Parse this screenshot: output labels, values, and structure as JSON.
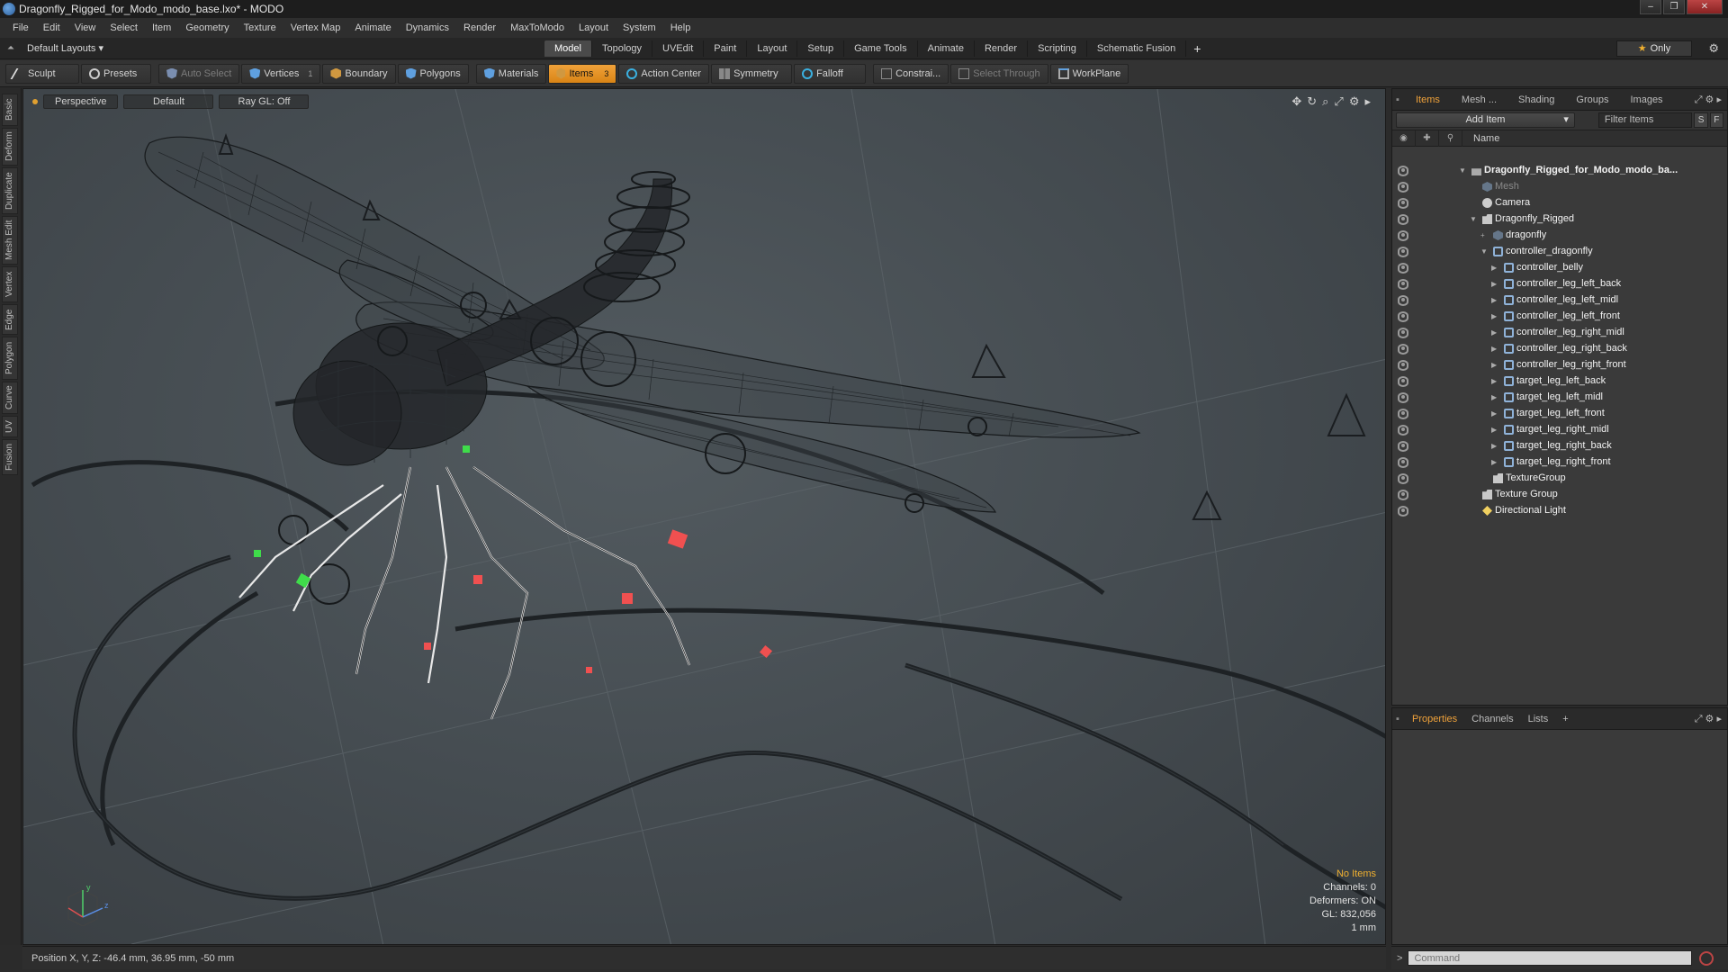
{
  "window": {
    "title": "Dragonfly_Rigged_for_Modo_modo_base.lxo* - MODO",
    "minimize": "–",
    "maximize": "❐",
    "close": "✕"
  },
  "menu": [
    "File",
    "Edit",
    "View",
    "Select",
    "Item",
    "Geometry",
    "Texture",
    "Vertex Map",
    "Animate",
    "Dynamics",
    "Render",
    "MaxToModo",
    "Layout",
    "System",
    "Help"
  ],
  "layoutbar": {
    "layouts_label": "Default Layouts ▾",
    "tabs": [
      "Model",
      "Topology",
      "UVEdit",
      "Paint",
      "Layout",
      "Setup",
      "Game Tools",
      "Animate",
      "Render",
      "Scripting",
      "Schematic Fusion"
    ],
    "active_tab": "Model",
    "plus": "+",
    "only_label": "Only"
  },
  "toolbar": {
    "sculpt": "Sculpt",
    "presets": "Presets",
    "auto_select": "Auto Select",
    "vertices": "Vertices",
    "vertices_count": "1",
    "boundary": "Boundary",
    "polygons": "Polygons",
    "materials": "Materials",
    "items": "Items",
    "items_count": "3",
    "action_center": "Action Center",
    "symmetry": "Symmetry",
    "falloff": "Falloff",
    "constraints": "Constrai...",
    "select_through": "Select Through",
    "workplane": "WorkPlane"
  },
  "left_tabs": [
    "Basic",
    "Deform",
    "Duplicate",
    "Mesh Edit",
    "Vertex",
    "Edge",
    "Polygon",
    "Curve",
    "UV",
    "Fusion"
  ],
  "viewport": {
    "view": "Perspective",
    "shading": "Default",
    "raygl": "Ray GL: Off",
    "info": {
      "no_items": "No Items",
      "channels": "Channels: 0",
      "deformers": "Deformers: ON",
      "gl": "GL: 832,056",
      "unit": "1 mm"
    },
    "axis_y": "y",
    "axis_z": "z"
  },
  "statusbar": {
    "position": "Position X, Y, Z:  -46.4 mm, 36.95 mm, -50 mm"
  },
  "items_panel": {
    "tabs": [
      "Items",
      "Mesh ...",
      "Shading",
      "Groups",
      "Images"
    ],
    "active_tab": "Items",
    "add_item": "Add Item",
    "filter_placeholder": "Filter Items",
    "s_btn": "S",
    "f_btn": "F",
    "name_header": "Name",
    "tree": [
      {
        "label": "Dragonfly_Rigged_for_Modo_modo_ba...",
        "depth": 0,
        "icon": "scene",
        "expanded": true,
        "bold": true
      },
      {
        "label": "Mesh",
        "depth": 1,
        "icon": "mesh",
        "dim": true
      },
      {
        "label": "Camera",
        "depth": 1,
        "icon": "cam"
      },
      {
        "label": "Dragonfly_Rigged",
        "depth": 1,
        "icon": "grp",
        "expanded": true
      },
      {
        "label": "dragonfly",
        "depth": 2,
        "icon": "mesh",
        "plus": true
      },
      {
        "label": "controller_dragonfly",
        "depth": 2,
        "icon": "loc",
        "expanded": true
      },
      {
        "label": "controller_belly",
        "depth": 3,
        "icon": "loc",
        "collapsed": true
      },
      {
        "label": "controller_leg_left_back",
        "depth": 3,
        "icon": "loc",
        "collapsed": true
      },
      {
        "label": "controller_leg_left_midl",
        "depth": 3,
        "icon": "loc",
        "collapsed": true
      },
      {
        "label": "controller_leg_left_front",
        "depth": 3,
        "icon": "loc",
        "collapsed": true
      },
      {
        "label": "controller_leg_right_midl",
        "depth": 3,
        "icon": "loc",
        "collapsed": true
      },
      {
        "label": "controller_leg_right_back",
        "depth": 3,
        "icon": "loc",
        "collapsed": true
      },
      {
        "label": "controller_leg_right_front",
        "depth": 3,
        "icon": "loc",
        "collapsed": true
      },
      {
        "label": "target_leg_left_back",
        "depth": 3,
        "icon": "loc",
        "collapsed": true
      },
      {
        "label": "target_leg_left_midl",
        "depth": 3,
        "icon": "loc",
        "collapsed": true
      },
      {
        "label": "target_leg_left_front",
        "depth": 3,
        "icon": "loc",
        "collapsed": true
      },
      {
        "label": "target_leg_right_midl",
        "depth": 3,
        "icon": "loc",
        "collapsed": true
      },
      {
        "label": "target_leg_right_back",
        "depth": 3,
        "icon": "loc",
        "collapsed": true
      },
      {
        "label": "target_leg_right_front",
        "depth": 3,
        "icon": "loc",
        "collapsed": true
      },
      {
        "label": "TextureGroup",
        "depth": 2,
        "icon": "grp"
      },
      {
        "label": "Texture Group",
        "depth": 1,
        "icon": "grp"
      },
      {
        "label": "Directional Light",
        "depth": 1,
        "icon": "light"
      }
    ]
  },
  "properties_panel": {
    "tabs": [
      "Properties",
      "Channels",
      "Lists"
    ],
    "active_tab": "Properties",
    "plus": "+"
  },
  "command": {
    "placeholder": "Command",
    "prompt": ">"
  },
  "colors": {
    "accent": "#f0a23a",
    "viewport_bg": "#4a5156",
    "ctrl_green": "#3fdc4a",
    "ctrl_red": "#f05050"
  }
}
